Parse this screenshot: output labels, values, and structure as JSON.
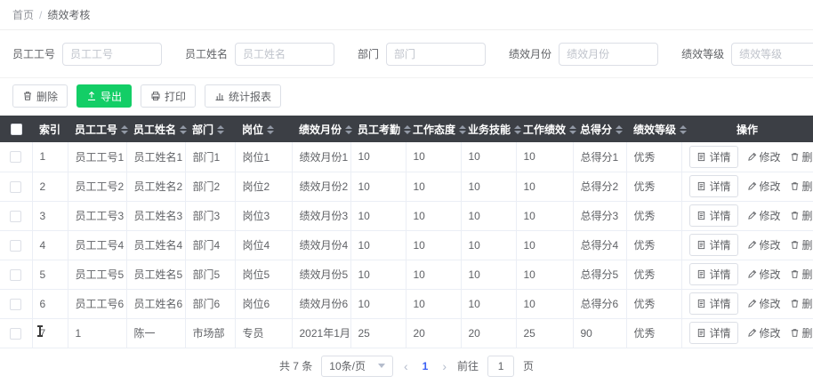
{
  "breadcrumb": {
    "home": "首页",
    "separator": "/",
    "current": "绩效考核"
  },
  "filters": [
    {
      "label": "员工工号",
      "placeholder": "员工工号"
    },
    {
      "label": "员工姓名",
      "placeholder": "员工姓名"
    },
    {
      "label": "部门",
      "placeholder": "部门"
    },
    {
      "label": "绩效月份",
      "placeholder": "绩效月份"
    },
    {
      "label": "绩效等级",
      "placeholder": "绩效等级"
    }
  ],
  "toolbar": {
    "delete_label": "删除",
    "export_label": "导出",
    "print_label": "打印",
    "report_label": "统计报表"
  },
  "colors": {
    "primary": "#3a5ff4",
    "success": "#13ce66",
    "header_bg": "#3c3f45"
  },
  "table": {
    "headers": [
      "索引",
      "员工工号",
      "员工姓名",
      "部门",
      "岗位",
      "绩效月份",
      "员工考勤",
      "工作态度",
      "业务技能",
      "工作绩效",
      "总得分",
      "绩效等级",
      "操作"
    ],
    "sortable": [
      false,
      true,
      true,
      true,
      true,
      true,
      true,
      true,
      true,
      true,
      true,
      true,
      false
    ],
    "actions": {
      "detail": "详情",
      "edit": "修改",
      "delete": "删除"
    },
    "rows": [
      {
        "index": "1",
        "cells": [
          "员工工号1",
          "员工姓名1",
          "部门1",
          "岗位1",
          "绩效月份1",
          "10",
          "10",
          "10",
          "10",
          "总得分1",
          "优秀"
        ]
      },
      {
        "index": "2",
        "cells": [
          "员工工号2",
          "员工姓名2",
          "部门2",
          "岗位2",
          "绩效月份2",
          "10",
          "10",
          "10",
          "10",
          "总得分2",
          "优秀"
        ]
      },
      {
        "index": "3",
        "cells": [
          "员工工号3",
          "员工姓名3",
          "部门3",
          "岗位3",
          "绩效月份3",
          "10",
          "10",
          "10",
          "10",
          "总得分3",
          "优秀"
        ]
      },
      {
        "index": "4",
        "cells": [
          "员工工号4",
          "员工姓名4",
          "部门4",
          "岗位4",
          "绩效月份4",
          "10",
          "10",
          "10",
          "10",
          "总得分4",
          "优秀"
        ]
      },
      {
        "index": "5",
        "cells": [
          "员工工号5",
          "员工姓名5",
          "部门5",
          "岗位5",
          "绩效月份5",
          "10",
          "10",
          "10",
          "10",
          "总得分5",
          "优秀"
        ]
      },
      {
        "index": "6",
        "cells": [
          "员工工号6",
          "员工姓名6",
          "部门6",
          "岗位6",
          "绩效月份6",
          "10",
          "10",
          "10",
          "10",
          "总得分6",
          "优秀"
        ]
      },
      {
        "index": "7",
        "cells": [
          "1",
          "陈一",
          "市场部",
          "专员",
          "2021年1月",
          "25",
          "20",
          "20",
          "25",
          "90",
          "优秀"
        ]
      }
    ]
  },
  "pagination": {
    "total_text": "共 7 条",
    "page_size": "10条/页",
    "current_page": "1",
    "goto_label": "前往",
    "goto_value": "1",
    "goto_unit": "页"
  }
}
